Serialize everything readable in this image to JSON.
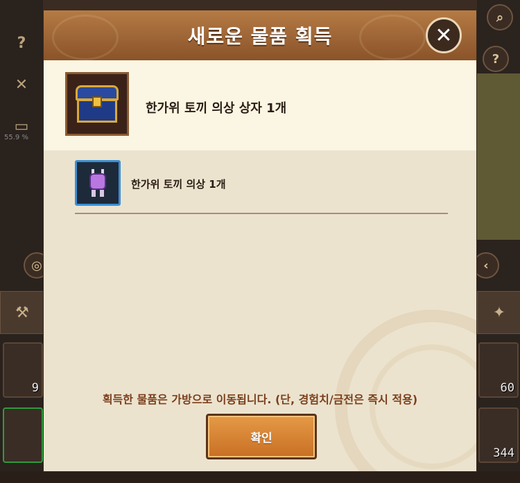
{
  "modal": {
    "title": "새로운 물품 획득",
    "close_icon": "close-icon",
    "reward_box": {
      "name": "한가위 토끼 의상 상자 1개",
      "icon": "treasure-chest-icon"
    },
    "result_items": [
      {
        "name": "한가위 토끼 의상 1개",
        "icon": "rabbit-costume-icon"
      }
    ],
    "notice": "획득한 물품은 가방으로 이동됩니다. (단, 경험치/금전은 즉시 적용)",
    "confirm_label": "확인"
  },
  "background": {
    "progress_percent": "55.9 %",
    "slot_counts": [
      "9",
      "60",
      "344"
    ],
    "side_icons": [
      "quest-scroll-icon",
      "crossed-swords-icon",
      "book-icon",
      "search-icon",
      "help-icon",
      "back-arrow-icon",
      "coin-icon"
    ]
  },
  "colors": {
    "header": "#a06a38",
    "panel": "#f3ead4",
    "confirm_button": "#d9842f",
    "item_frame_blue": "#3a8fd6"
  }
}
